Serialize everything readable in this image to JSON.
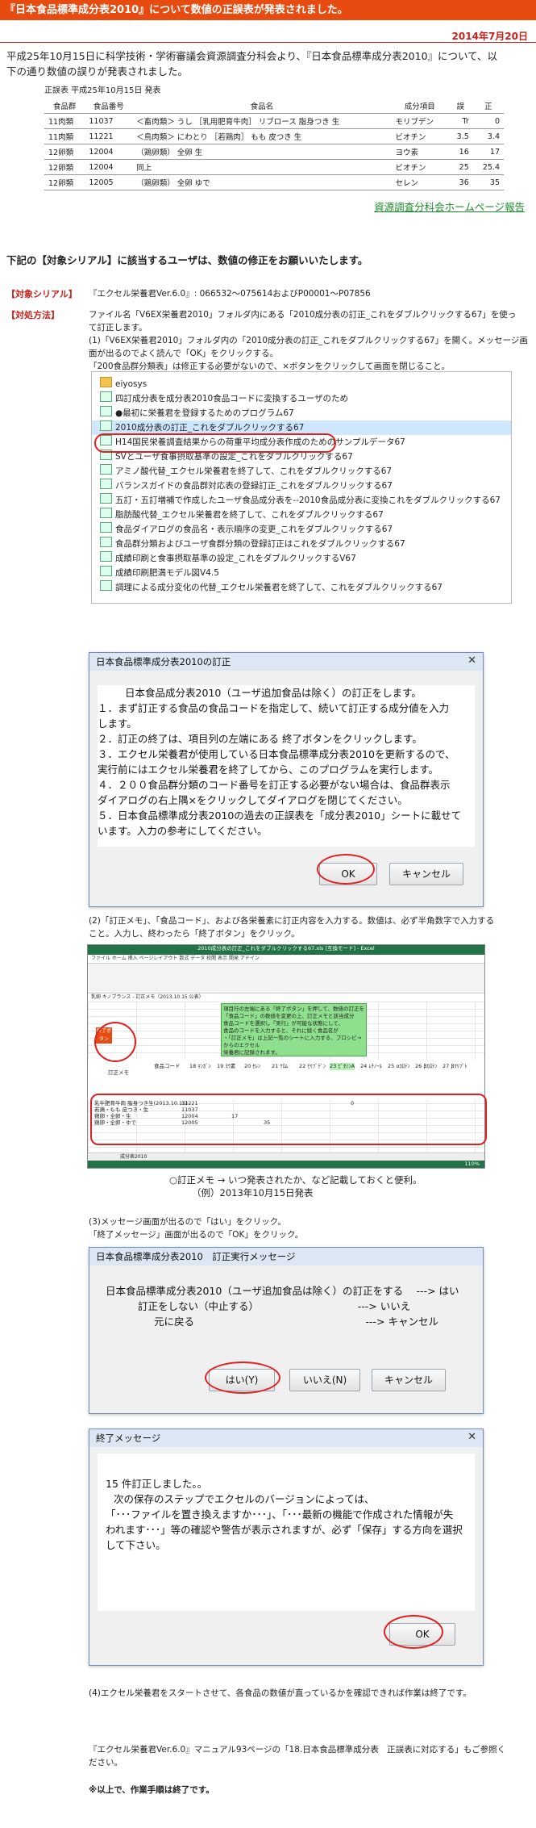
{
  "header": {
    "title": "『日本食品標準成分表2010』について数値の正誤表が発表されました。",
    "date": "2014年7月20日"
  },
  "intro": {
    "line1": "平成25年10月15日に科学技術・学術審議会資源調査分科会より、『日本食品標準成分表2010』について、以",
    "line2": "下の通り数値の誤りが発表されました。"
  },
  "errata": {
    "caption": "正誤表 平成25年10月15日 発表",
    "headers": [
      "食品群",
      "食品番号",
      "食品名",
      "成分項目",
      "誤",
      "正"
    ],
    "rows": [
      [
        "11肉類",
        "11037",
        "＜畜肉類＞ うし ［乳用肥育牛肉］ リブロース 脂身つき 生",
        "モリブデン",
        "Tr",
        "0"
      ],
      [
        "11肉類",
        "11221",
        "＜鳥肉類＞ にわとり ［若鶏肉］ もも 皮つき 生",
        "ビオチン",
        "3.5",
        "3.4"
      ],
      [
        "12卵類",
        "12004",
        "（鶏卵類） 全卵 生",
        "ヨウ素",
        "16",
        "17"
      ],
      [
        "12卵類",
        "12004",
        "同上",
        "ビオチン",
        "25",
        "25.4"
      ],
      [
        "12卵類",
        "12005",
        "（鶏卵類） 全卵 ゆで",
        "セレン",
        "36",
        "35"
      ]
    ]
  },
  "report_link": "資源調査分科会ホームページ報告",
  "notice": "下記の【対象シリアル】に該当するユーザは、数値の修正をお願いいたします。",
  "serial": {
    "label": "【対象シリアル】",
    "value": "『エクセル栄養君Ver.6.0』: 066532〜075614およびP00001〜P07856"
  },
  "method": {
    "label": "【対処方法】",
    "line1": "ファイル名「V6EX栄養君2010」フォルダ内にある「2010成分表の訂正_これをダブルクリックする67」を使っ",
    "line2": "て訂正します。",
    "step1a": "(1)「V6EX栄養君2010」フォルダ内の「2010成分表の訂正_これをダブルクリックする67」を開く。メッセージ画",
    "step1b": "面が出るのでよく読んで「OK」をクリックする。",
    "step1c": "「200食品群分類表」は修正する必要がないので、×ボタンをクリックして画面を閉じること。"
  },
  "folder": {
    "items": [
      {
        "icon": "folder-icon",
        "label": "eiyosys"
      },
      {
        "icon": "file-icon",
        "label": "四訂成分表を成分表2010食品コードに変換するユーザのため"
      },
      {
        "icon": "file-icon",
        "label": "●最初に栄養君を登録するためのプログラム67"
      },
      {
        "icon": "file-icon",
        "label": "2010成分表の訂正_これをダブルクリックする67"
      },
      {
        "icon": "file-icon",
        "label": "H14国民栄養調査結果からの荷重平均成分表作成のためのサンプルデータ67"
      },
      {
        "icon": "file-icon",
        "label": "SVとユーザ食事摂取基準の設定_これをダブルクリックする67"
      },
      {
        "icon": "file-icon",
        "label": "アミノ酸代替_エクセル栄養君を終了して、これをダブルクリックする67"
      },
      {
        "icon": "file-icon",
        "label": "バランスガイドの食品群対応表の登録訂正_これをダブルクリックする67"
      },
      {
        "icon": "file-icon",
        "label": "五訂・五訂増補で作成したユーザ食品成分表を--2010食品成分表に変換これをダブルクリックする67"
      },
      {
        "icon": "file-icon",
        "label": "脂肪酸代替_エクセル栄養君を終了して、これをダブルクリックする67"
      },
      {
        "icon": "file-icon",
        "label": "食品ダイアログの食品名・表示順序の変更_これをダブルクリックする67"
      },
      {
        "icon": "file-icon",
        "label": "食品群分類およびユーザ食群分類の登録訂正はこれをダブルクリックする67"
      },
      {
        "icon": "file-icon",
        "label": "成績印刷と食事摂取基準の設定_これをダブルクリックするV67"
      },
      {
        "icon": "file-icon",
        "label": "成績印刷肥満モデル図V4.5"
      },
      {
        "icon": "file-icon",
        "label": "調理による成分変化の代替_エクセル栄養君を終了して、これをダブルクリックする67"
      }
    ]
  },
  "dialog1": {
    "title": "日本食品標準成分表2010の訂正",
    "line1": "日本食品成分表2010（ユーザ追加食品は除く）の訂正をします。",
    "line2": "１．まず訂正する食品の食品コードを指定して、続いて訂正する成分値を入力",
    "line3": "します。",
    "line4": "２．訂正の終了は、項目列の左端にある 終了ボタンをクリックします。",
    "line5": "３．エクセル栄養君が使用している日本食品標準成分表2010を更新するので、",
    "line6": "実行前にはエクセル栄養君を終了してから、このプログラムを実行します。",
    "line7": "４．２００食品群分類のコード番号を訂正する必要がない場合は、食品群表示",
    "line8": "ダイアログの右上隅×をクリックしてダイアログを閉じてください。",
    "line9": "５．日本食品標準成分表2010の過去の正誤表を「成分表2010」シートに載せて",
    "line10": "います。入力の参考にしてください。",
    "ok": "OK",
    "cancel": "キャンセル"
  },
  "step2": {
    "line1": "(2)「訂正メモ」、「食品コード」、および各栄養素に訂正内容を入力する。数値は、必ず半角数字で入力する",
    "line2": "こと。入力し、終わったら「終了ボタン」をクリック。"
  },
  "excel": {
    "title": "2010成分表の訂正_これをダブルクリックする67.xls [互換モード] - Excel",
    "menu": "ファイル  ホーム  挿入  ページレイアウト  数式  データ  校閲  表示  開発  アドイン",
    "formula": "乳卵 キノブランス - 訂正メモ（2013.10.15 公表）",
    "end_button": "終了ボタン",
    "col_memo": "訂正メモ",
    "col_code": "食品コード",
    "headers": [
      "18 ﾏﾝｶﾞﾝ",
      "19 ﾖｳ素",
      "20 ｾﾚﾝ",
      "21 ｸﾛﾑ",
      "22 ﾓﾘﾌﾞﾃﾞﾝ",
      "23 ﾋﾞﾀﾐﾝA",
      "24 ﾚﾁﾉｰﾙ",
      "25 αｶﾛﾃﾝ",
      "26 βｶﾛﾃﾝ",
      "27 βｸﾘﾌﾟﾄ"
    ],
    "rows": [
      {
        "memo": "乳牛肥育牛肉 脂身つき生(2013.10.15)",
        "code": "11221",
        "a": "",
        "b": "",
        "c": "",
        "d": "0"
      },
      {
        "memo": "若鶏・もも 皮つき・生",
        "code": "11037",
        "a": "",
        "b": "",
        "c": "",
        "d": ""
      },
      {
        "memo": "鶏卵・全卵・生",
        "code": "12004",
        "a": "17",
        "b": "",
        "c": "",
        "d": ""
      },
      {
        "memo": "鶏卵・全卵・ゆで",
        "code": "12005",
        "a": "",
        "b": "35",
        "c": "",
        "d": ""
      }
    ],
    "note_lines": [
      "項目行の左端にある「終了ボタン」を押して、数値の訂正を",
      "「食品コード」の数値を変更の上、訂正メモと該当成分",
      "食品コードを選択し「実行」が可能な状態にして、",
      "食品のコードを入力すると、それに続く食品名が",
      "・「訂正メモ」は上記一覧のシートに入力する、プロシビ→からのエクセル",
      "栄養君に記録されます。"
    ],
    "tab": "成分表2010",
    "zoom": "110%"
  },
  "caption": {
    "line1": "○訂正メモ → いつ発表されたか、など記載しておくと便利。",
    "line2": "（例）2013年10月15日発表"
  },
  "step3": {
    "line1": "(3)メッセージ画面が出るので「はい」をクリック。",
    "line2": "「終了メッセージ」画面が出るので「OK」をクリック。"
  },
  "dialog2": {
    "title": "日本食品標準成分表2010　訂正実行メッセージ",
    "line1": "日本食品標準成分表2010（ユーザ追加食品は除く）の訂正をする　 ---> はい",
    "line2": "訂正をしない（中止する）　　　　　　　　　　 ---> いいえ",
    "line3": "元に戻る　　　　　　　　　　　　　　　　　---> キャンセル",
    "yes": "はい(Y)",
    "no": "いいえ(N)",
    "cancel": "キャンセル"
  },
  "dialog3": {
    "title": "終了メッセージ",
    "line1": "15 件訂正しました。。",
    "line2": "次の保存のステップでエクセルのバージョンによっては、",
    "line3": "「･･･ファイルを置き換えますか･･･」、「･･･最新の機能で作成された情報が失",
    "line4": "われます･･･」等の確認や警告が表示されますが、必ず「保存」する方向を選択",
    "line5": "して下さい。",
    "ok": "OK"
  },
  "step4": "(4)エクセル栄養君をスタートさせて、各食品の数値が直っているかを確認できれば作業は終了です。",
  "manual": {
    "line1": "『エクセル栄養君Ver.6.0』マニュアル93ページの「18.日本食品標準成分表　正誤表に対応する」もご参照く",
    "line2": "ださい。"
  },
  "end_note": "※以上で、作業手順は終了です。",
  "colors": {
    "accent": "#e84b10",
    "alert": "#c8201a",
    "link": "#1a8f2a",
    "excel": "#217346"
  }
}
